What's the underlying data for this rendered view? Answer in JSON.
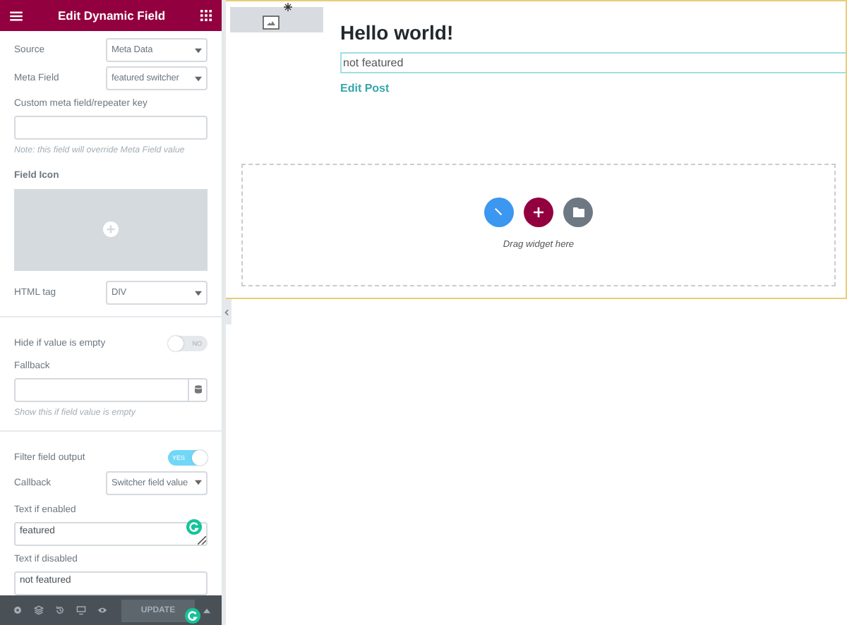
{
  "panel": {
    "title": "Edit Dynamic Field",
    "fields": [
      {
        "kind": "select",
        "label": "Source",
        "value": "Meta Data"
      },
      {
        "kind": "select",
        "label": "Meta Field",
        "value": "featured switcher"
      },
      {
        "kind": "text",
        "label": "Custom meta field/repeater key",
        "dynamic": false
      },
      {
        "kind": "note",
        "text": "Note: this field will override Meta Field value"
      },
      {
        "kind": "icon",
        "label": "Field Icon"
      },
      {
        "kind": "select",
        "label": "HTML tag",
        "value": "DIV"
      },
      {
        "kind": "divider"
      },
      {
        "kind": "toggle",
        "label": "Hide if value is empty",
        "on": false,
        "state_text": "NO"
      },
      {
        "kind": "text",
        "label": "Fallback",
        "dynamic": true
      },
      {
        "kind": "note",
        "text": "Show this if field value is empty"
      },
      {
        "kind": "divider"
      },
      {
        "kind": "toggle",
        "label": "Filter field output",
        "on": true,
        "state_text": "YES"
      },
      {
        "kind": "select",
        "label": "Callback",
        "value": "Switcher field value"
      },
      {
        "kind": "textarea",
        "label": "Text if enabled",
        "value": "featured",
        "assistant": true
      },
      {
        "kind": "textarea",
        "label": "Text if disabled",
        "value": "not featured",
        "assistant": false
      }
    ],
    "footer": {
      "update": "UPDATE"
    }
  },
  "canvas": {
    "title": "Hello world!",
    "field_value": "not featured",
    "link": "Edit Post",
    "drop_hint": "Drag widget here"
  }
}
